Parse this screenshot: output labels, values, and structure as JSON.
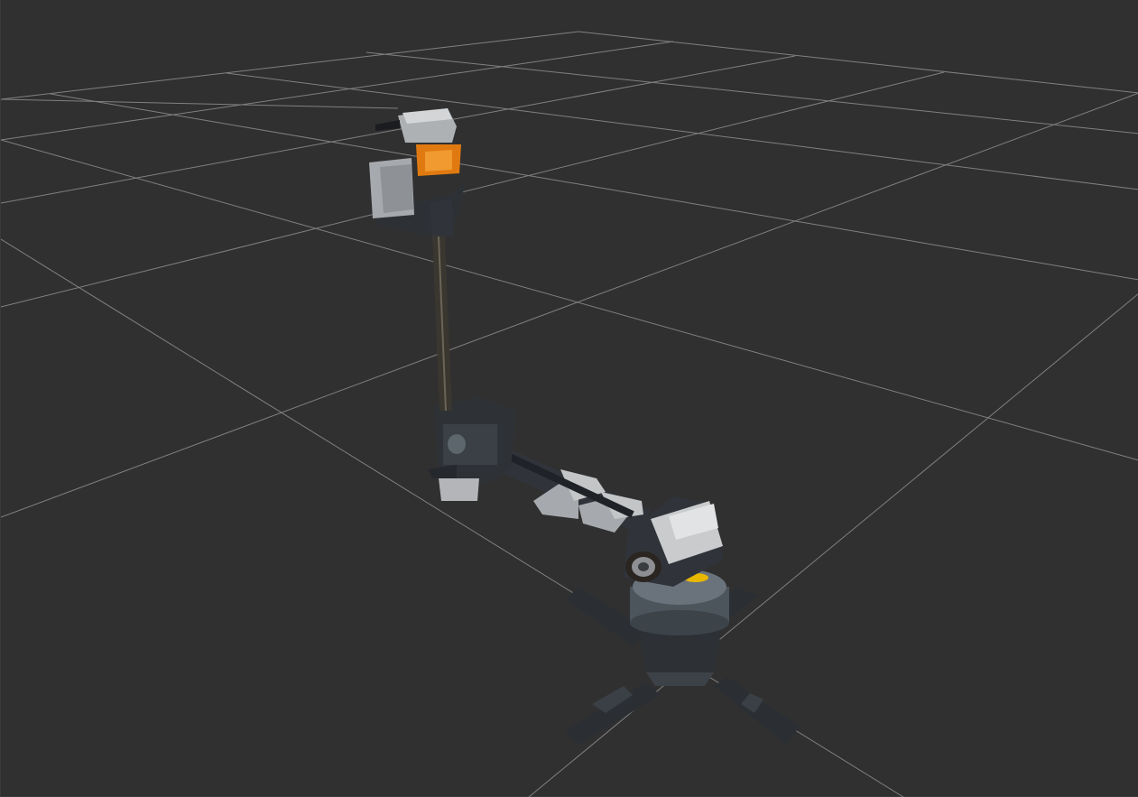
{
  "scene": {
    "background_color": "#303030",
    "grid_color": "#a0a0a0",
    "grid_visible": true,
    "robot": {
      "name_icon": "robot-arm-icon",
      "colors": {
        "dark_link": "#2e3238",
        "mid_link": "#454b52",
        "light_panel": "#c9cbcd",
        "silver": "#a6a9ad",
        "highlight_orange": "#e07a10",
        "rod": "#3a3630",
        "yellow_accent": "#e8b800"
      }
    }
  }
}
